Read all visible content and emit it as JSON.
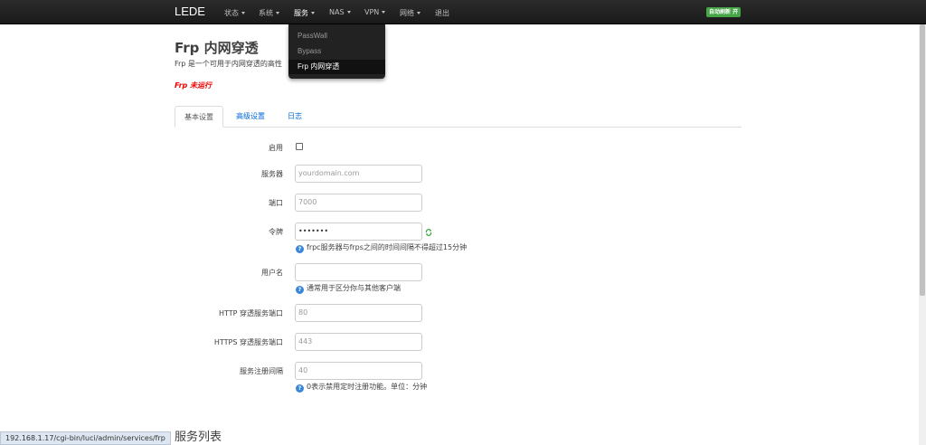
{
  "navbar": {
    "brand": "LEDE",
    "menus": [
      {
        "label": "状态"
      },
      {
        "label": "系统"
      },
      {
        "label": "服务"
      },
      {
        "label": "NAS"
      },
      {
        "label": "VPN"
      },
      {
        "label": "网络"
      }
    ],
    "logout": "退出",
    "badge": "自动刷新 开"
  },
  "dropdown": {
    "items": [
      {
        "label": "PassWall"
      },
      {
        "label": "Bypass"
      },
      {
        "label": "Frp 内网穿透"
      }
    ]
  },
  "page": {
    "title": "Frp 内网穿透",
    "description": "Frp 是一个可用于内网穿透的高性",
    "status": "Frp 未运行"
  },
  "tabs": [
    {
      "label": "基本设置"
    },
    {
      "label": "高级设置"
    },
    {
      "label": "日志"
    }
  ],
  "form": {
    "enable_label": "启用",
    "server_label": "服务器",
    "server_placeholder": "yourdomain.com",
    "port_label": "端口",
    "port_placeholder": "7000",
    "token_label": "令牌",
    "token_value": "•••••••",
    "token_help": "frpc服务器与frps之间的时间间隔不得超过15分钟",
    "user_label": "用户名",
    "user_help": "通常用于区分你与其他客户端",
    "http_label": "HTTP 穿透服务端口",
    "http_placeholder": "80",
    "https_label": "HTTPS 穿透服务端口",
    "https_placeholder": "443",
    "interval_label": "服务注册间隔",
    "interval_placeholder": "40",
    "interval_help": "0表示禁用定时注册功能。单位：分钟",
    "help_glyph": "?"
  },
  "section_title": "服务列表",
  "statusbar_url": "192.168.1.17/cgi-bin/luci/admin/services/frp",
  "colors": {
    "navbar": "#1a1a1a",
    "link": "#0069d6",
    "status_error": "#e00000",
    "badge": "#46a546",
    "reveal_icon": "#3ca63c"
  },
  "icons": {
    "help": "help-circle-icon",
    "reveal": "reveal-password-icon",
    "caret": "chevron-down-icon"
  }
}
